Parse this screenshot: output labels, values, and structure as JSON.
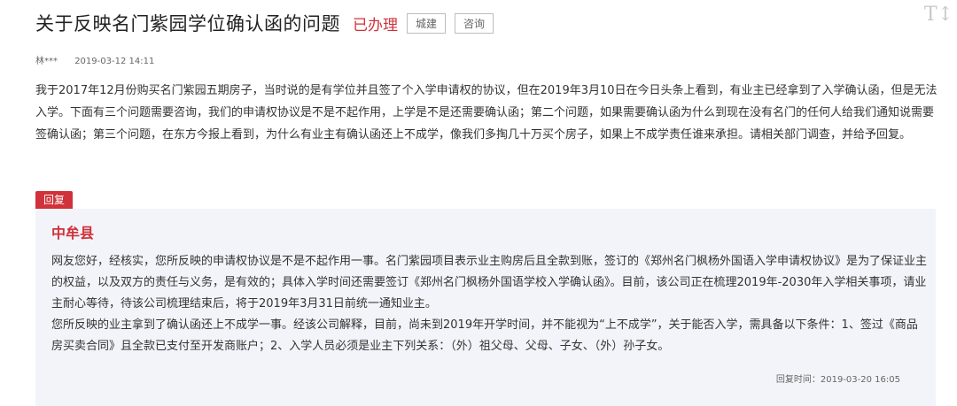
{
  "header": {
    "title": "关于反映名门紫园学位确认函的问题",
    "status": "已办理",
    "tags": [
      "城建",
      "咨询"
    ],
    "font_tool_label": "T↕"
  },
  "meta": {
    "author": "林***",
    "date": "2019-03-12 14:11"
  },
  "question": {
    "text": "我于2017年12月份购买名门紫园五期房子，当时说的是有学位并且签了个入学申请权的协议，但在2019年3月10日在今日头条上看到，有业主已经拿到了入学确认函，但是无法入学。下面有三个问题需要咨询，我们的申请权协议是不是不起作用，上学是不是还需要确认函；第二个问题，如果需要确认函为什么到现在没有名门的任何人给我们通知说需要签确认函；第三个问题，在东方今报上看到，为什么有业主有确认函还上不成学，像我们多掏几十万买个房子，如果上不成学责任谁来承担。请相关部门调查，并给予回复。"
  },
  "reply": {
    "badge": "回复",
    "department": "中牟县",
    "paragraph1": "网友您好，经核实，您所反映的申请权协议是不是不起作用一事。名门紫园项目表示业主购房后且全款到账，签订的《郑州名门枫杨外国语入学申请权协议》是为了保证业主的权益，以及双方的责任与义务，是有效的；具体入学时间还需要签订《郑州名门枫杨外国语学校入学确认函》。目前，该公司正在梳理2019年-2030年入学相关事项，请业主耐心等待，待该公司梳理结束后，将于2019年3月31日前统一通知业主。",
    "paragraph2": "您所反映的业主拿到了确认函还上不成学一事。经该公司解释，目前，尚未到2019年开学时间，并不能视为“上不成学”，关于能否入学，需具备以下条件：1、签过《商品房买卖合同》且全款已支付至开发商账户；2、入学人员必须是业主下列关系：（外）祖父母、父母、子女、（外）孙子女。",
    "time": "回复时间：2019-03-20 16:05"
  }
}
